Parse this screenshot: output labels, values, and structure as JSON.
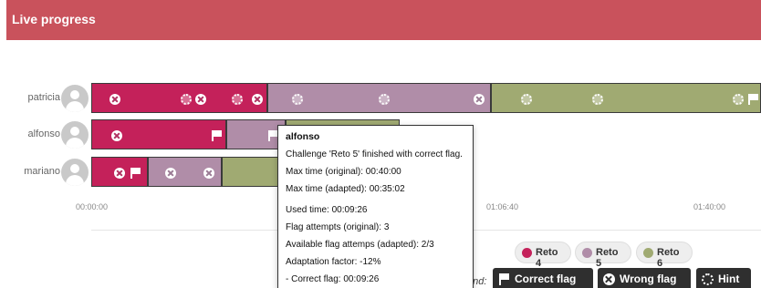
{
  "header": {
    "title": "Live progress"
  },
  "colors": {
    "reto4": "#c4215a",
    "reto5": "#b08da8",
    "reto6": "#a0aa72",
    "header": "#c9525c"
  },
  "users": [
    {
      "name": "patricia"
    },
    {
      "name": "alfonso"
    },
    {
      "name": "mariano"
    }
  ],
  "axis": {
    "ticks": [
      "00:00:00",
      "01:06:40",
      "01:40:00"
    ]
  },
  "tooltip": {
    "title": "alfonso",
    "lines": [
      "Challenge 'Reto 5' finished with correct flag.",
      "Max time (original): 00:40:00",
      "Max time (adapted): 00:35:02",
      "Used time: 00:09:26",
      "Flag attempts (original): 3",
      "Available flag attemps (adapted): 2/3",
      "Adaptation factor: -12%",
      "- Correct flag: 00:09:26"
    ]
  },
  "challenges": [
    {
      "label": "Reto 4"
    },
    {
      "label": "Reto 5"
    },
    {
      "label": "Reto 6"
    }
  ],
  "legend": {
    "label": "end:",
    "correct_flag": "Correct flag",
    "wrong_flag": "Wrong flag",
    "hint": "Hint"
  }
}
